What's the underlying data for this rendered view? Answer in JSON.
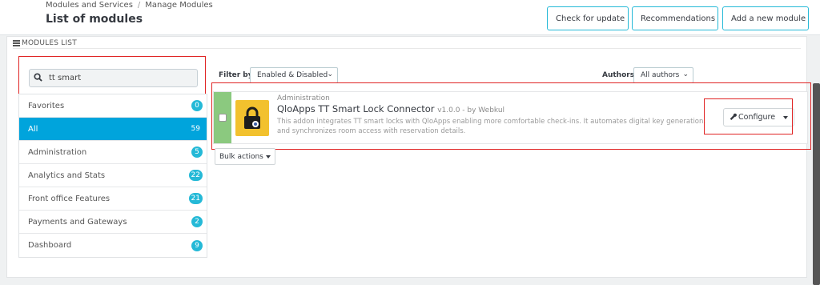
{
  "header": {
    "breadcrumb": [
      "Modules and Services",
      "Manage Modules"
    ],
    "breadcrumb_sep": "/",
    "title": "List of modules",
    "buttons": [
      {
        "label": "Check for update",
        "icon": "refresh-icon"
      },
      {
        "label": "Recommendations",
        "icon": "puzzle-icon"
      },
      {
        "label": "Add a new module",
        "icon": "plus-circle-icon"
      }
    ]
  },
  "panel": {
    "heading": "MODULES LIST",
    "search": {
      "value": "tt smart",
      "icon": "search-icon"
    },
    "categories": [
      {
        "label": "Favorites",
        "count": "0",
        "active": false
      },
      {
        "label": "All",
        "count": "59",
        "active": true
      },
      {
        "label": "Administration",
        "count": "5",
        "active": false
      },
      {
        "label": "Analytics and Stats",
        "count": "22",
        "active": false
      },
      {
        "label": "Front office Features",
        "count": "21",
        "active": false
      },
      {
        "label": "Payments and Gateways",
        "count": "2",
        "active": false
      },
      {
        "label": "Dashboard",
        "count": "9",
        "active": false
      }
    ],
    "filter": {
      "label": "Filter by",
      "value": "Enabled & Disabled"
    },
    "authors": {
      "label": "Authors",
      "value": "All authors"
    },
    "module": {
      "category": "Administration",
      "name": "QloApps TT Smart Lock Connector",
      "version": "v1.0.0 - by Webkul",
      "description": "This addon integrates TT smart locks with QloApps enabling more comfortable check-ins. It automates digital key generation, and synchronizes room access with reservation details.",
      "action": "Configure",
      "logo_icon": "lock-icon"
    },
    "bulk_actions": "Bulk actions"
  },
  "colors": {
    "accent": "#25b9d7",
    "active_category": "#00a4dc",
    "enabled_strip": "#8bc97f",
    "logo_bg": "#f2c12e",
    "highlight": "#e02424"
  }
}
